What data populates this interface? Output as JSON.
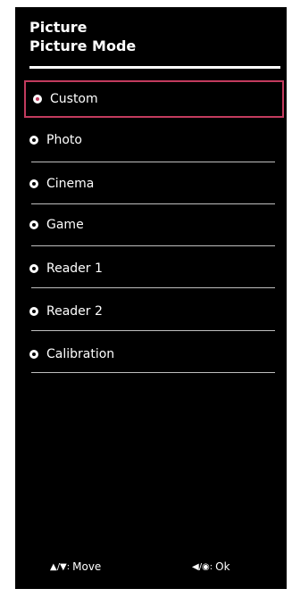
{
  "header": {
    "title_line1": "Picture",
    "title_line2": "Picture Mode"
  },
  "menu": {
    "items": [
      {
        "label": "Custom",
        "selected": true
      },
      {
        "label": "Photo",
        "selected": false
      },
      {
        "label": "Cinema",
        "selected": false
      },
      {
        "label": "Game",
        "selected": false
      },
      {
        "label": "Reader 1",
        "selected": false
      },
      {
        "label": "Reader 2",
        "selected": false
      },
      {
        "label": "Calibration",
        "selected": false
      }
    ]
  },
  "footer": {
    "move_keys": "▲/▼:",
    "move_label": "Move",
    "ok_keys": "◀/◉:",
    "ok_label": "Ok"
  },
  "colors": {
    "panel_background": "#000000",
    "selection_border": "#c23b5e",
    "text": "#ffffff"
  }
}
